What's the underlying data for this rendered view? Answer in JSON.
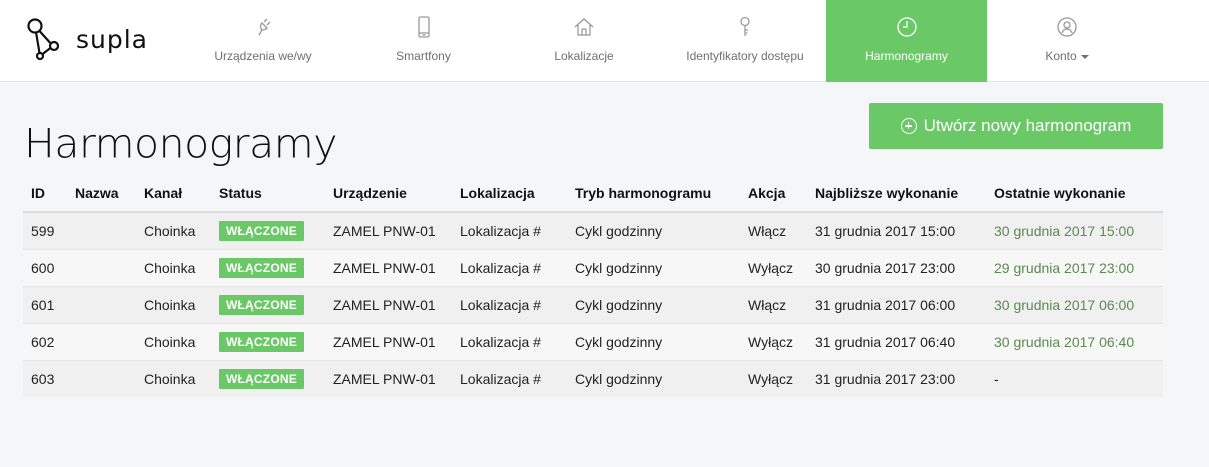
{
  "brand": {
    "name": "supla"
  },
  "nav": {
    "items": [
      {
        "label": "Urządzenia we/wy",
        "icon": "plug-icon",
        "active": false
      },
      {
        "label": "Smartfony",
        "icon": "smartphone-icon",
        "active": false
      },
      {
        "label": "Lokalizacje",
        "icon": "home-icon",
        "active": false
      },
      {
        "label": "Identyfikatory dostępu",
        "icon": "key-icon",
        "active": false
      },
      {
        "label": "Harmonogramy",
        "icon": "clock-icon",
        "active": true
      },
      {
        "label": "Konto",
        "icon": "user-icon",
        "active": false
      }
    ]
  },
  "page": {
    "title": "Harmonogramy",
    "create_button_label": "Utwórz nowy harmonogram"
  },
  "table": {
    "headers": [
      "ID",
      "Nazwa",
      "Kanał",
      "Status",
      "Urządzenie",
      "Lokalizacja",
      "Tryb harmonogramu",
      "Akcja",
      "Najbliższe wykonanie",
      "Ostatnie wykonanie"
    ],
    "rows": [
      {
        "id": "599",
        "name": "",
        "channel": "Choinka",
        "status": "WŁĄCZONE",
        "device": "ZAMEL PNW-01",
        "location": "Lokalizacja #",
        "mode": "Cykl godzinny",
        "action": "Włącz",
        "next": "31 grudnia 2017 15:00",
        "last": "30 grudnia 2017 15:00"
      },
      {
        "id": "600",
        "name": "",
        "channel": "Choinka",
        "status": "WŁĄCZONE",
        "device": "ZAMEL PNW-01",
        "location": "Lokalizacja #",
        "mode": "Cykl godzinny",
        "action": "Wyłącz",
        "next": "30 grudnia 2017 23:00",
        "last": "29 grudnia 2017 23:00"
      },
      {
        "id": "601",
        "name": "",
        "channel": "Choinka",
        "status": "WŁĄCZONE",
        "device": "ZAMEL PNW-01",
        "location": "Lokalizacja #",
        "mode": "Cykl godzinny",
        "action": "Włącz",
        "next": "31 grudnia 2017 06:00",
        "last": "30 grudnia 2017 06:00"
      },
      {
        "id": "602",
        "name": "",
        "channel": "Choinka",
        "status": "WŁĄCZONE",
        "device": "ZAMEL PNW-01",
        "location": "Lokalizacja #",
        "mode": "Cykl godzinny",
        "action": "Wyłącz",
        "next": "31 grudnia 2017 06:40",
        "last": "30 grudnia 2017 06:40"
      },
      {
        "id": "603",
        "name": "",
        "channel": "Choinka",
        "status": "WŁĄCZONE",
        "device": "ZAMEL PNW-01",
        "location": "Lokalizacja #",
        "mode": "Cykl godzinny",
        "action": "Wyłącz",
        "next": "31 grudnia 2017 23:00",
        "last": "-"
      }
    ]
  },
  "colors": {
    "accent": "#6ac966",
    "last_execution": "#5a8a4f"
  }
}
